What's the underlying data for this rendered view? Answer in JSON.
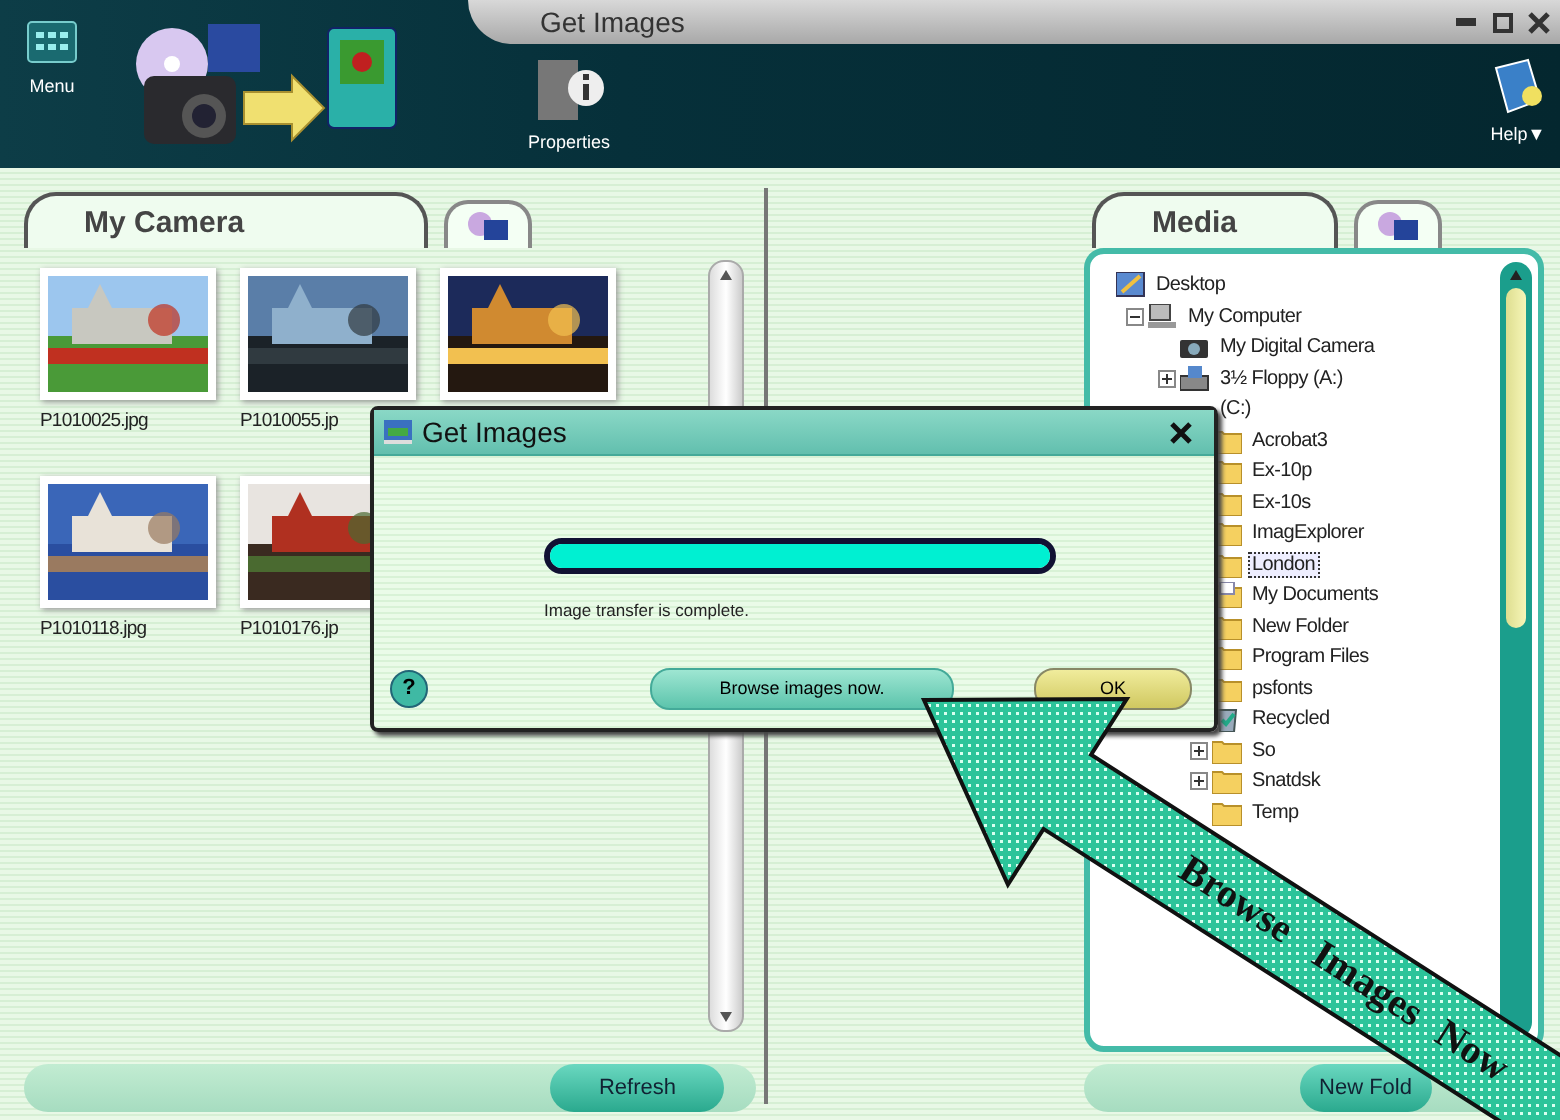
{
  "window": {
    "title": "Get Images"
  },
  "toolbar": {
    "menu": "Menu",
    "properties": "Properties",
    "help": "Help▼"
  },
  "camera_panel": {
    "tabs": [
      {
        "label": "My Camera",
        "selected": true
      },
      {
        "selected": false
      }
    ],
    "thumbnails": [
      {
        "name": "P1010025.jpg",
        "kind": "picture"
      },
      {
        "name": "P1010055.jp",
        "kind": "picture"
      },
      {
        "kind": "picture"
      },
      {
        "name": "P1010118.jpg",
        "kind": "picture"
      },
      {
        "name": "P1010176.jp",
        "kind": "picture"
      }
    ],
    "button": "Refresh"
  },
  "media_panel": {
    "tabs": [
      {
        "label": "Media",
        "selected": true
      },
      {
        "selected": false
      }
    ],
    "tree": [
      {
        "label": "Desktop",
        "kind": "desktop",
        "selected": false,
        "children": [
          {
            "label": "My Computer",
            "kind": "computer",
            "expanded": true,
            "selected": false,
            "children": [
              {
                "label": "My Digital Camera",
                "kind": "camera",
                "selected": false
              },
              {
                "label": "3½ Floppy (A:)",
                "kind": "floppy",
                "expanded": false,
                "selected": false
              },
              {
                "label": "(C:)",
                "selected": false,
                "children": [
                  {
                    "label": "Acrobat3",
                    "kind": "folder",
                    "selected": false
                  },
                  {
                    "label": "Ex-10p",
                    "kind": "folder",
                    "selected": false
                  },
                  {
                    "label": "Ex-10s",
                    "kind": "folder",
                    "selected": false
                  },
                  {
                    "label": "ImagExplorer",
                    "kind": "folder",
                    "selected": false
                  },
                  {
                    "label": "London",
                    "kind": "folder",
                    "selected": true
                  },
                  {
                    "label": "My Documents",
                    "kind": "documents",
                    "selected": false
                  },
                  {
                    "label": "New Folder",
                    "kind": "folder",
                    "selected": false
                  },
                  {
                    "label": "Program Files",
                    "kind": "folder",
                    "selected": false
                  },
                  {
                    "label": "psfonts",
                    "kind": "folder",
                    "selected": false
                  },
                  {
                    "label": "Recycled",
                    "kind": "recycle",
                    "selected": false
                  },
                  {
                    "label": "So",
                    "kind": "folder",
                    "expanded": false,
                    "selected": false
                  },
                  {
                    "label": "Snatdsk",
                    "kind": "folder",
                    "expanded": false,
                    "selected": false
                  },
                  {
                    "label": "Temp",
                    "kind": "folder",
                    "selected": false
                  }
                ]
              }
            ]
          }
        ]
      }
    ],
    "button": "New Fold"
  },
  "dialog": {
    "title": "Get Images",
    "progress": {
      "level": 1
    },
    "message": "Image transfer is complete.",
    "help": "?",
    "buttons": [
      {
        "label": "Browse images now.",
        "kind": "primary"
      },
      {
        "label": "OK",
        "kind": "default"
      }
    ]
  },
  "annotation": {
    "words": [
      "Browse",
      "Images",
      "Now"
    ]
  }
}
